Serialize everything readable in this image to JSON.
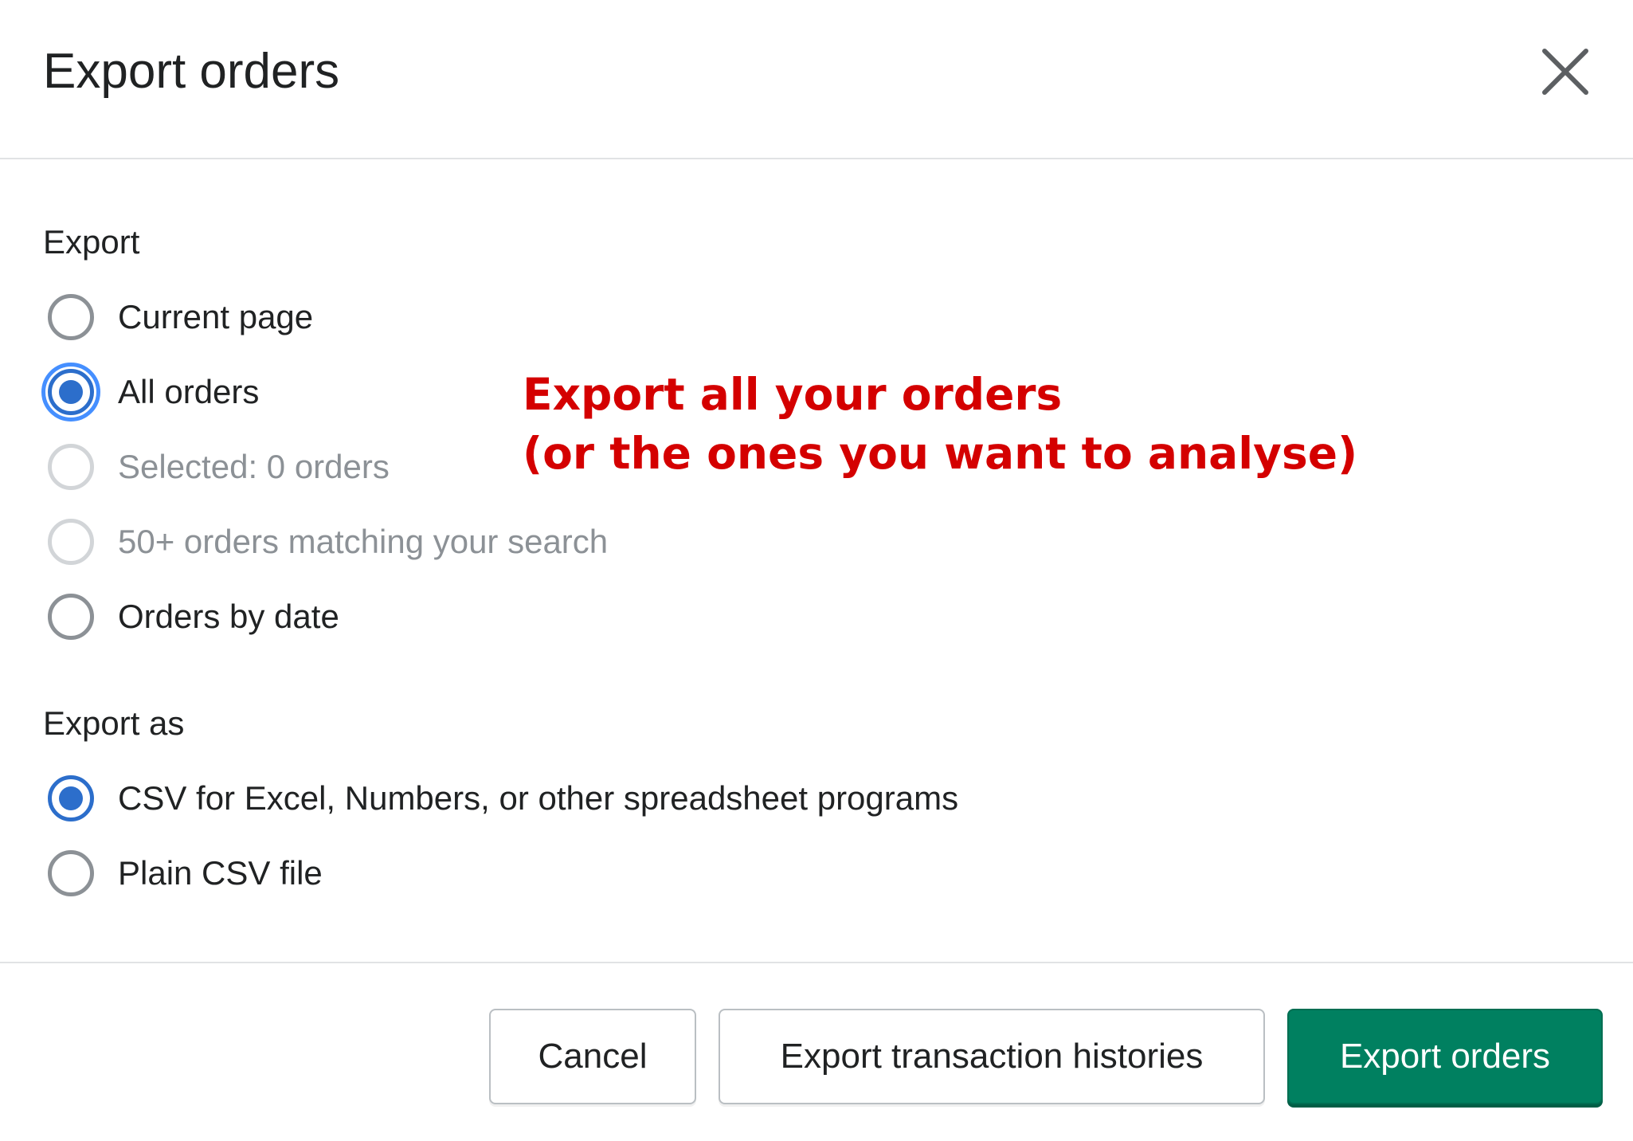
{
  "dialog": {
    "title": "Export orders",
    "close_icon": "close-icon"
  },
  "export_section": {
    "label": "Export",
    "options": [
      {
        "label": "Current page",
        "checked": false,
        "disabled": false
      },
      {
        "label": "All orders",
        "checked": true,
        "disabled": false,
        "focused": true
      },
      {
        "label": "Selected: 0 orders",
        "checked": false,
        "disabled": true
      },
      {
        "label": "50+ orders matching your search",
        "checked": false,
        "disabled": true
      },
      {
        "label": "Orders by date",
        "checked": false,
        "disabled": false
      }
    ]
  },
  "export_as_section": {
    "label": "Export as",
    "options": [
      {
        "label": "CSV for Excel, Numbers, or other spreadsheet programs",
        "checked": true,
        "disabled": false
      },
      {
        "label": "Plain CSV file",
        "checked": false,
        "disabled": false
      }
    ]
  },
  "annotation": {
    "line1": "Export all your orders",
    "line2": "(or the ones you want to analyse)",
    "color": "#d40000"
  },
  "footer": {
    "cancel_label": "Cancel",
    "export_histories_label": "Export transaction histories",
    "export_orders_label": "Export orders"
  },
  "colors": {
    "primary": "#008060",
    "radio_checked": "#2c6ecb",
    "focus_ring": "#458fff",
    "disabled_text": "#8c9196"
  }
}
